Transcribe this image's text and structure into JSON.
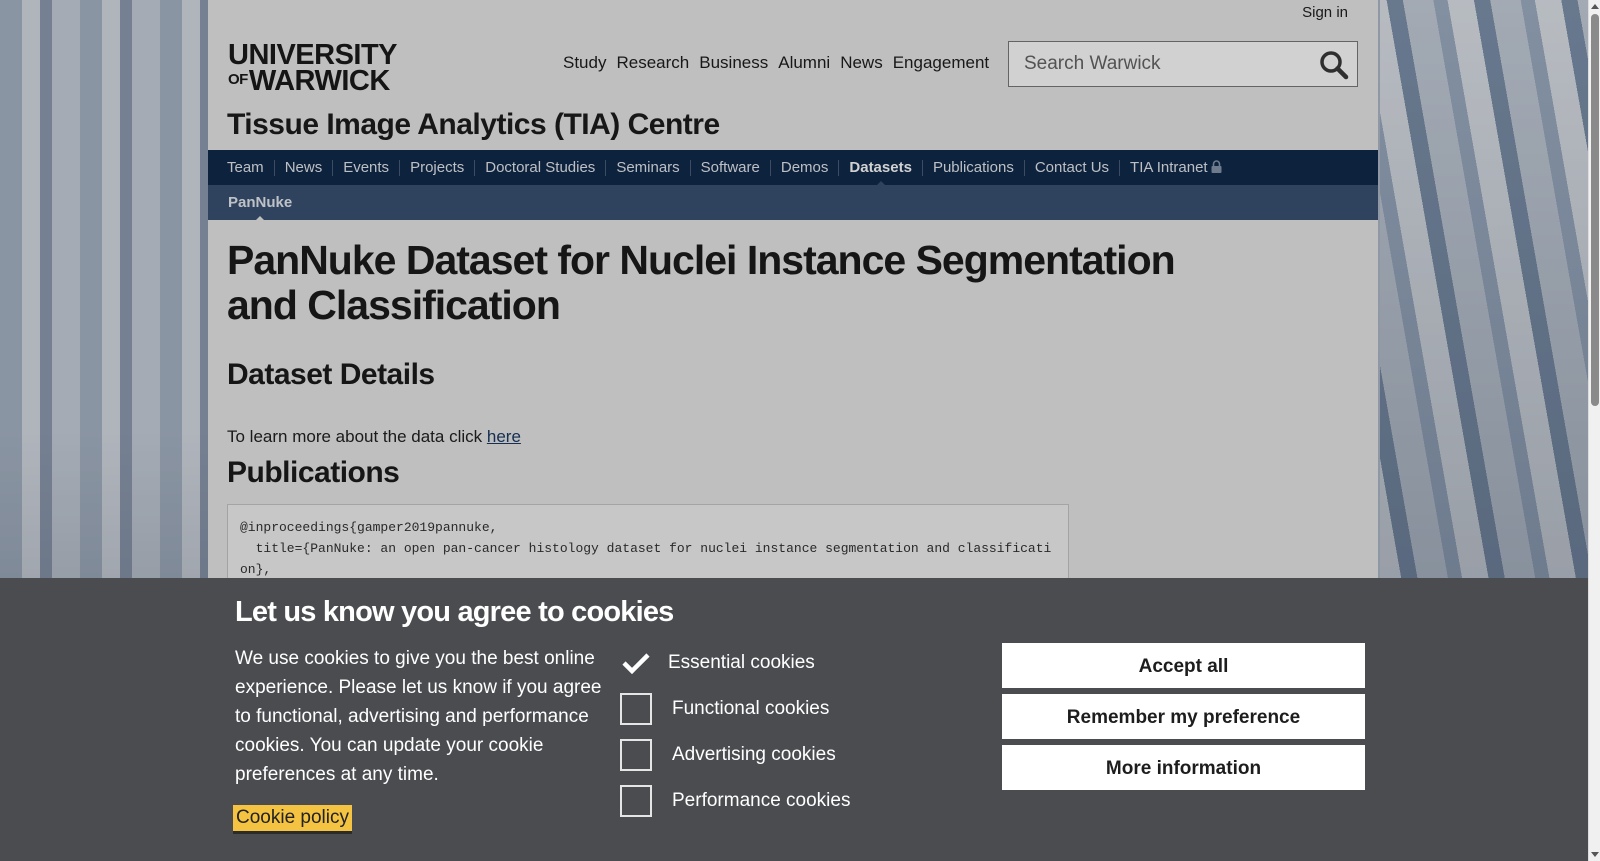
{
  "header": {
    "sign_in": "Sign in",
    "logo_line1": "UNIVERSITY",
    "logo_of": "OF",
    "logo_line2": "WARWICK",
    "main_nav": [
      "Study",
      "Research",
      "Business",
      "Alumni",
      "News",
      "Engagement"
    ],
    "search_placeholder": "Search Warwick",
    "site_title": "Tissue Image Analytics (TIA) Centre"
  },
  "dept_nav": {
    "items": [
      "Team",
      "News",
      "Events",
      "Projects",
      "Doctoral Studies",
      "Seminars",
      "Software",
      "Demos",
      "Datasets",
      "Publications",
      "Contact Us",
      "TIA Intranet"
    ],
    "active": "Datasets"
  },
  "sub_nav": {
    "current": "PanNuke"
  },
  "content": {
    "title": "PanNuke Dataset for Nuclei Instance Segmentation and Classification",
    "section1_heading": "Dataset Details",
    "learn_text": "To learn more about the data click ",
    "learn_link": "here",
    "section2_heading": "Publications",
    "bibtex": "@inproceedings{gamper2019pannuke,\n  title={PanNuke: an open pan-cancer histology dataset for nuclei instance segmentation and classificati\non},"
  },
  "cookie_banner": {
    "heading": "Let us know you agree to cookies",
    "description": "We use cookies to give you the best online experience. Please let us know if you agree to functional, advertising and performance cookies. You can update your cookie preferences at any time.",
    "policy_link": "Cookie policy",
    "options": [
      {
        "label": "Essential cookies",
        "checked": true
      },
      {
        "label": "Functional cookies",
        "checked": false
      },
      {
        "label": "Advertising cookies",
        "checked": false
      },
      {
        "label": "Performance cookies",
        "checked": false
      }
    ],
    "buttons": {
      "accept_all": "Accept all",
      "remember": "Remember my preference",
      "more_info": "More information"
    }
  },
  "colors": {
    "dept_nav_bg": "#112a4b",
    "sub_nav_bg": "#3b5273",
    "cookie_bg": "#4a4c50",
    "cookie_policy_bg": "#f5c342"
  }
}
